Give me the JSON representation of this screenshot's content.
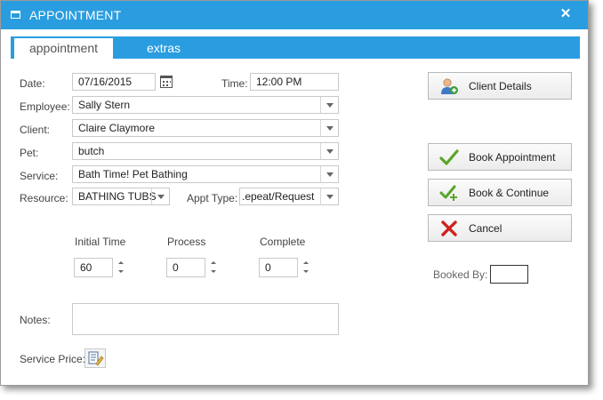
{
  "window": {
    "title": "APPOINTMENT",
    "close_glyph": "✕",
    "accent": "#2a9de0"
  },
  "tabs": [
    {
      "label": "appointment",
      "active": true
    },
    {
      "label": "extras",
      "active": false
    }
  ],
  "form": {
    "date_label": "Date:",
    "date_value": "07/16/2015",
    "time_label": "Time:",
    "time_value": "12:00 PM",
    "employee_label": "Employee:",
    "employee_value": "Sally Stern",
    "client_label": "Client:",
    "client_value": "Claire Claymore",
    "pet_label": "Pet:",
    "pet_value": "butch",
    "service_label": "Service:",
    "service_value": "Bath Time! Pet Bathing",
    "resource_label": "Resource:",
    "resource_value": "BATHING TUBS",
    "appt_type_label": "Appt Type:",
    "appt_type_value": ".epeat/Request"
  },
  "durations": [
    {
      "label": "Initial Time",
      "value": "60"
    },
    {
      "label": "Process",
      "value": "0"
    },
    {
      "label": "Complete",
      "value": "0"
    }
  ],
  "notes_label": "Notes:",
  "service_price_label": "Service Price:",
  "buttons": {
    "client_details": "Client Details",
    "book_appointment": "Book Appointment",
    "book_continue": "Book & Continue",
    "cancel": "Cancel"
  },
  "booked_by_label": "Booked By:",
  "icons": {
    "title": "window-icon",
    "calendar": "calendar-icon",
    "client": "user-add-icon",
    "book": "checkmark-icon",
    "continue": "checkmark-plus-icon",
    "cancel": "red-x-icon",
    "price": "edit-list-icon"
  }
}
